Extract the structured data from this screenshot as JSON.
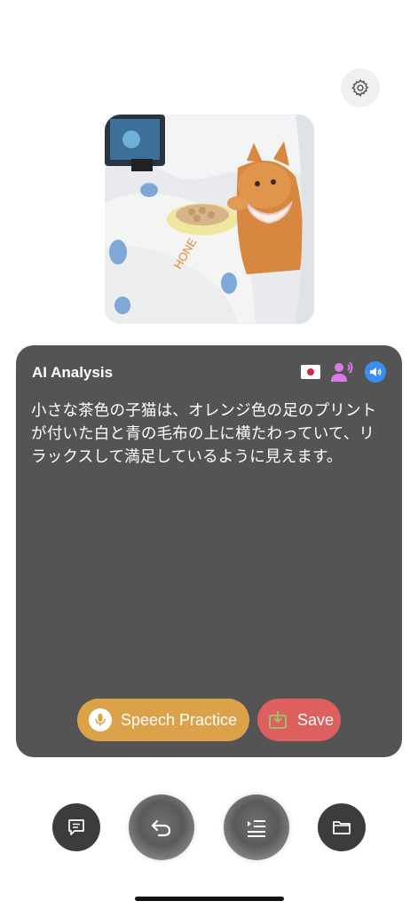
{
  "header": {
    "settings_icon": "gear-icon"
  },
  "photo": {
    "description_icon": "cat-photo"
  },
  "analysis": {
    "title": "AI Analysis",
    "language_flag": "japan-flag",
    "voice_icon": "person-speaking-icon",
    "speaker_icon": "speaker-icon",
    "text": "小さな茶色の子猫は、オレンジ色の足のプリントが付いた白と青の毛布の上に横たわっていて、リラックスして満足しているように見えます。",
    "speech_practice_label": "Speech Practice",
    "save_label": "Save"
  },
  "dock": {
    "buttons": [
      "chat-icon",
      "undo-icon",
      "list-indent-icon",
      "folder-icon"
    ]
  },
  "colors": {
    "panel_bg": "#545454",
    "speech_btn": "#dba24a",
    "save_btn": "#dd5f5e",
    "speaker_blue": "#3b8df2",
    "voice_purple": "#d97ae8"
  }
}
